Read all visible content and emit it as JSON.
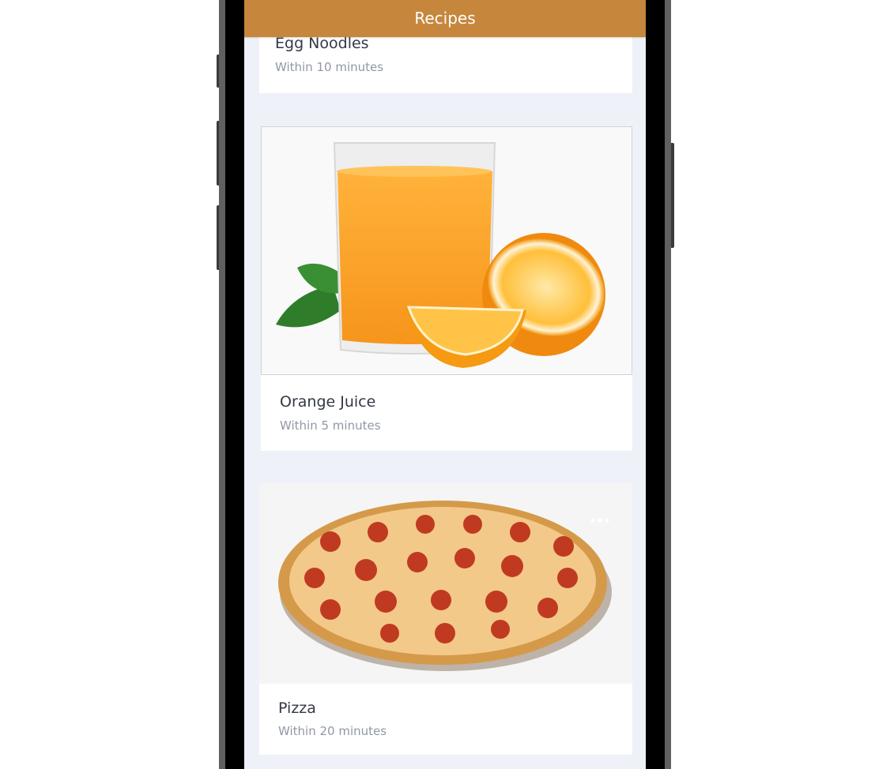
{
  "app_bar": {
    "title": "Recipes"
  },
  "recipes": [
    {
      "name": "Egg Noodles",
      "time": "Within 10 minutes",
      "image": "egg-noodles-image"
    },
    {
      "name": "Orange Juice",
      "time": "Within 5 minutes",
      "image": "orange-juice-image"
    },
    {
      "name": "Pizza",
      "time": "Within 20 minutes",
      "image": "pizza-image"
    }
  ],
  "colors": {
    "app_bar": "#c6873d",
    "screen_bg": "#eef1f7",
    "card_bg": "#ffffff",
    "title_text": "#333844",
    "subtitle_text": "#9097a6"
  },
  "icons": {
    "card_menu": "more-horizontal-icon"
  }
}
